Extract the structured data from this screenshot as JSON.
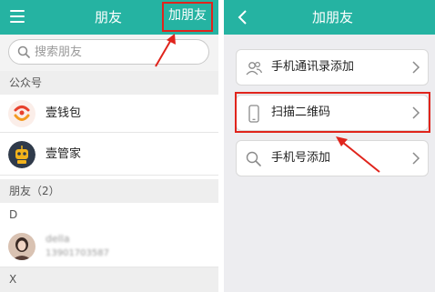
{
  "left": {
    "header": {
      "title": "朋友",
      "add_friend": "加朋友"
    },
    "search": {
      "placeholder": "搜索朋友"
    },
    "public_accounts": {
      "header": "公众号",
      "items": [
        {
          "name": "壹钱包",
          "icon": "wallet-logo-icon"
        },
        {
          "name": "壹管家",
          "icon": "butler-robot-icon"
        }
      ]
    },
    "friends": {
      "header": "朋友（2）",
      "index_d": "D",
      "contact": {
        "name": "della",
        "phone": "13901703587"
      },
      "index_x": "X"
    }
  },
  "right": {
    "header": {
      "title": "加朋友"
    },
    "options": [
      {
        "label": "手机通讯录添加",
        "icon": "contacts-icon"
      },
      {
        "label": "扫描二维码",
        "icon": "phone-scan-icon"
      },
      {
        "label": "手机号添加",
        "icon": "search-icon"
      }
    ]
  },
  "colors": {
    "header": "#25b3a2",
    "annotation": "#e0241c"
  }
}
